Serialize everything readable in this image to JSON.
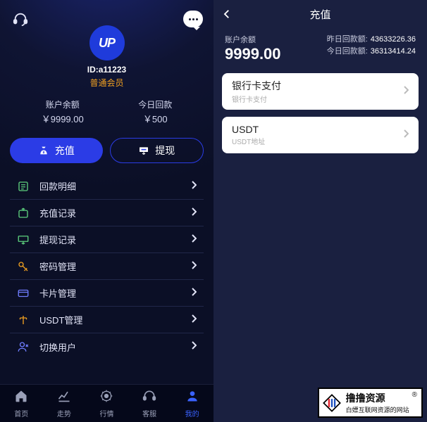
{
  "left": {
    "avatar_text": "UP",
    "user_id": "ID:a11223",
    "tier": "普通会员",
    "balance_label": "账户余额",
    "balance_value": "￥9999.00",
    "today_label": "今日回款",
    "today_value": "￥500",
    "btn_recharge": "充值",
    "btn_withdraw": "提现",
    "menu": [
      {
        "label": "回款明细",
        "icon": "#5ccf7d"
      },
      {
        "label": "充值记录",
        "icon": "#5ccf7d"
      },
      {
        "label": "提现记录",
        "icon": "#5ccf7d"
      },
      {
        "label": "密码管理",
        "icon": "#f0a020"
      },
      {
        "label": "卡片管理",
        "icon": "#6f7dff"
      },
      {
        "label": "USDT管理",
        "icon": "#f0a020"
      },
      {
        "label": "切换用户",
        "icon": "#6f7dff"
      }
    ],
    "tabs": [
      {
        "label": "首页"
      },
      {
        "label": "走势"
      },
      {
        "label": "行情"
      },
      {
        "label": "客服"
      },
      {
        "label": "我的"
      }
    ]
  },
  "right": {
    "title": "充值",
    "balance_label": "账户余额",
    "balance_value": "9999.00",
    "yest_label": "昨日回款额:",
    "yest_value": "43633226.36",
    "today_label": "今日回款额:",
    "today_value": "36313414.24",
    "options": [
      {
        "title": "银行卡支付",
        "sub": "银行卡支付"
      },
      {
        "title": "USDT",
        "sub": "USDT地址"
      }
    ]
  },
  "watermark": {
    "line1": "撸撸资源",
    "line2": "白嫖互联网资源的网站"
  }
}
